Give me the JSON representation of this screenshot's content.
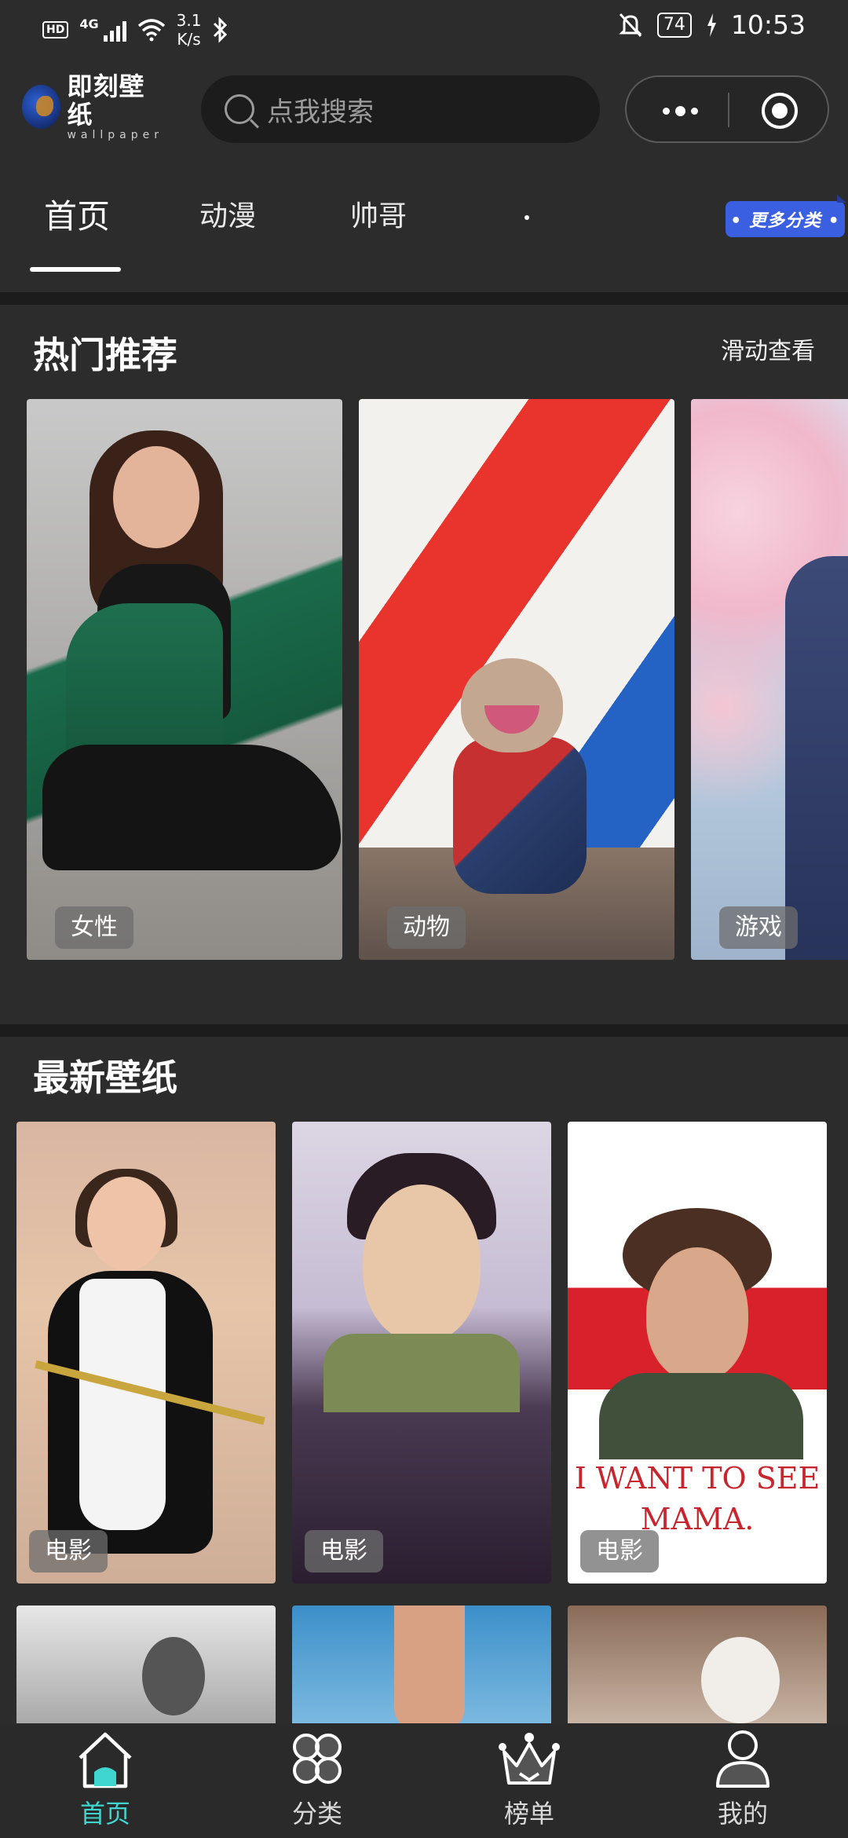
{
  "status_bar": {
    "hd": "HD",
    "network": "4G",
    "speed_value": "3.1",
    "speed_unit": "K/s",
    "battery": "74",
    "time": "10:53"
  },
  "header": {
    "logo_cn": "即刻壁纸",
    "logo_en": "wallpaper",
    "search_placeholder": "点我搜索"
  },
  "tabs": {
    "items": [
      "首页",
      "动漫",
      "帅哥"
    ],
    "active_index": 0,
    "more_label": "• 更多分类 •"
  },
  "hot": {
    "title": "热门推荐",
    "link": "滑动查看",
    "cards": [
      {
        "tag": "女性"
      },
      {
        "tag": "动物"
      },
      {
        "tag": "游戏"
      }
    ]
  },
  "latest": {
    "title": "最新壁纸",
    "cards": [
      {
        "tag": "电影"
      },
      {
        "tag": "电影"
      },
      {
        "tag": "电影",
        "poster_line1": "I WANT TO SEE",
        "poster_line2": "MAMA."
      }
    ]
  },
  "bottom_nav": {
    "items": [
      {
        "label": "首页",
        "icon": "home-icon",
        "active": true
      },
      {
        "label": "分类",
        "icon": "category-icon",
        "active": false
      },
      {
        "label": "榜单",
        "icon": "crown-icon",
        "active": false
      },
      {
        "label": "我的",
        "icon": "profile-icon",
        "active": false
      }
    ],
    "active_color": "#3fd6cf"
  },
  "colors": {
    "background": "#2c2c2c",
    "more_category_badge": "#3a5fe0",
    "accent": "#3fd6cf"
  }
}
